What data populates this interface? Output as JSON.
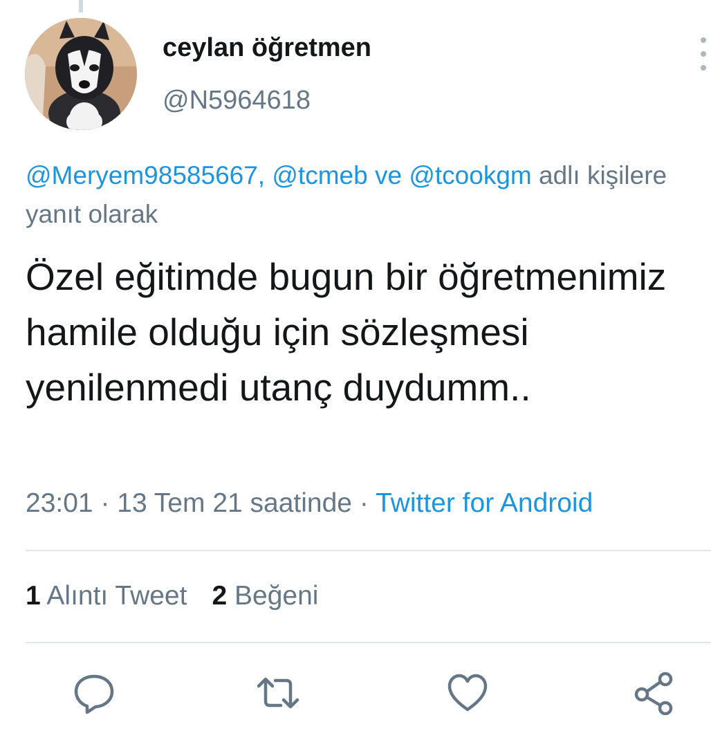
{
  "author": {
    "display_name": "ceylan öğretmen",
    "handle": "@N5964618",
    "avatar_icon": "husky-puppy-avatar"
  },
  "reply_context": {
    "mentions": [
      "@Meryem98585667,",
      "@tcmeb",
      "@tcookgm"
    ],
    "connector": "ve",
    "suffix": "adlı kişilere yanıt olarak"
  },
  "tweet": {
    "text": "Özel eğitimde bugun bir öğretmenimiz hamile olduğu için sözleşmesi yenilenmedi utanç duydumm..",
    "time": "23:01",
    "date": "13 Tem 21 saatinde",
    "separator": "·",
    "source": "Twitter for Android"
  },
  "stats": {
    "quote_count": "1",
    "quote_label": "Alıntı Tweet",
    "like_count": "2",
    "like_label": "Beğeni"
  },
  "actions": [
    "reply-icon",
    "retweet-icon",
    "like-icon",
    "share-icon"
  ],
  "colors": {
    "link": "#1b95e0",
    "secondary_text": "#657786",
    "primary_text": "#14171a",
    "divider": "#e1e8ed",
    "icon": "#657786"
  }
}
